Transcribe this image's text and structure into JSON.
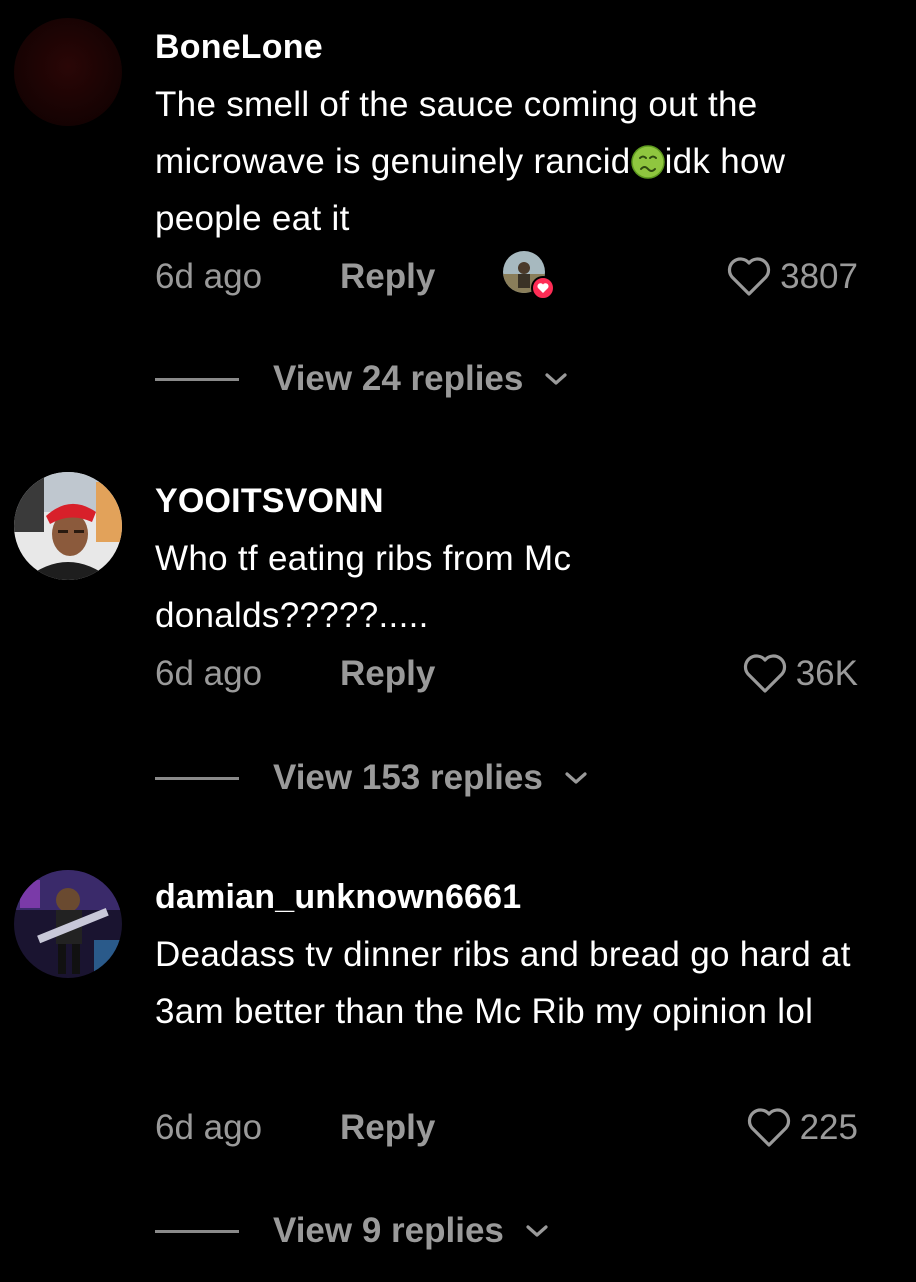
{
  "comments": [
    {
      "username": "BoneLone",
      "text_before_emoji": "The smell of the sauce coming out the microwave is genuinely rancid",
      "emoji_icon": "nauseated-face-icon",
      "text_after_emoji": "idk how people eat it",
      "time": "6d ago",
      "reply_label": "Reply",
      "likes": "3807",
      "liked_by_creator": true,
      "view_replies": "View 24 replies"
    },
    {
      "username": "YOOITSVONN",
      "text": "Who tf eating ribs from Mc donalds?????.....",
      "time": "6d ago",
      "reply_label": "Reply",
      "likes": "36K",
      "view_replies": "View 153 replies"
    },
    {
      "username": "damian_unknown6661",
      "text": "Deadass tv dinner ribs and bread go hard at 3am better than the Mc Rib my opinion lol",
      "time": "6d ago",
      "reply_label": "Reply",
      "likes": "225",
      "view_replies": "View 9 replies"
    }
  ],
  "icons": {
    "heart": "heart-outline-icon",
    "chevron": "chevron-down-icon",
    "creator_like_badge": "heart-badge-icon"
  },
  "colors": {
    "background": "#000000",
    "primary_text": "#ffffff",
    "secondary_text": "#9a9a9a",
    "like_badge": "#fe2c55"
  }
}
